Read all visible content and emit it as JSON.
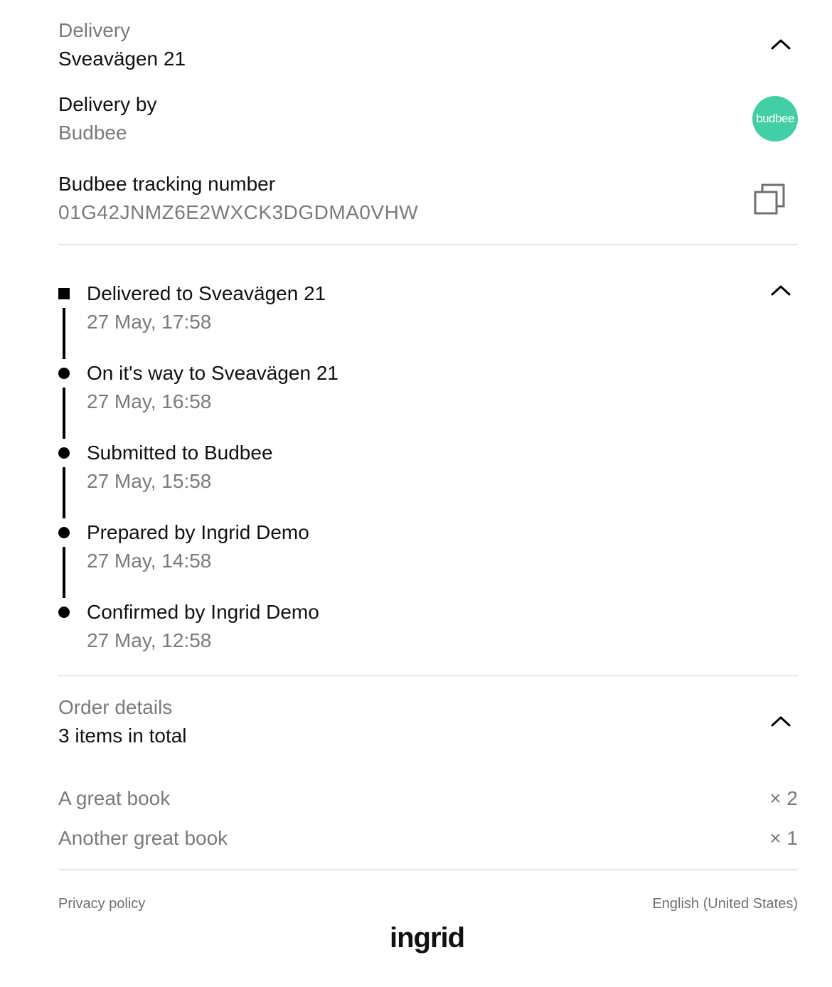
{
  "delivery": {
    "heading": "Delivery",
    "address": "Sveavägen 21",
    "by_heading": "Delivery by",
    "carrier": "Budbee",
    "carrier_logo_text": "budbee",
    "tracking_heading": "Budbee tracking number",
    "tracking_number": "01G42JNMZ6E2WXCK3DGDMA0VHW",
    "brand_color": "#43cfa6"
  },
  "timeline": {
    "events": [
      {
        "title": "Delivered to Sveavägen 21",
        "time": "27 May, 17:58"
      },
      {
        "title": "On it's way to Sveavägen 21",
        "time": "27 May, 16:58"
      },
      {
        "title": "Submitted to Budbee",
        "time": "27 May, 15:58"
      },
      {
        "title": "Prepared by Ingrid Demo",
        "time": "27 May, 14:58"
      },
      {
        "title": "Confirmed by Ingrid Demo",
        "time": "27 May, 12:58"
      }
    ]
  },
  "order": {
    "heading": "Order details",
    "summary": "3 items in total",
    "items": [
      {
        "name": "A great book",
        "qty": "× 2"
      },
      {
        "name": "Another great book",
        "qty": "× 1"
      }
    ]
  },
  "footer": {
    "privacy": "Privacy policy",
    "language": "English (United States)",
    "brand": "ingrid"
  },
  "icons": {
    "collapse": "chevron-up-icon",
    "copy": "copy-icon"
  }
}
